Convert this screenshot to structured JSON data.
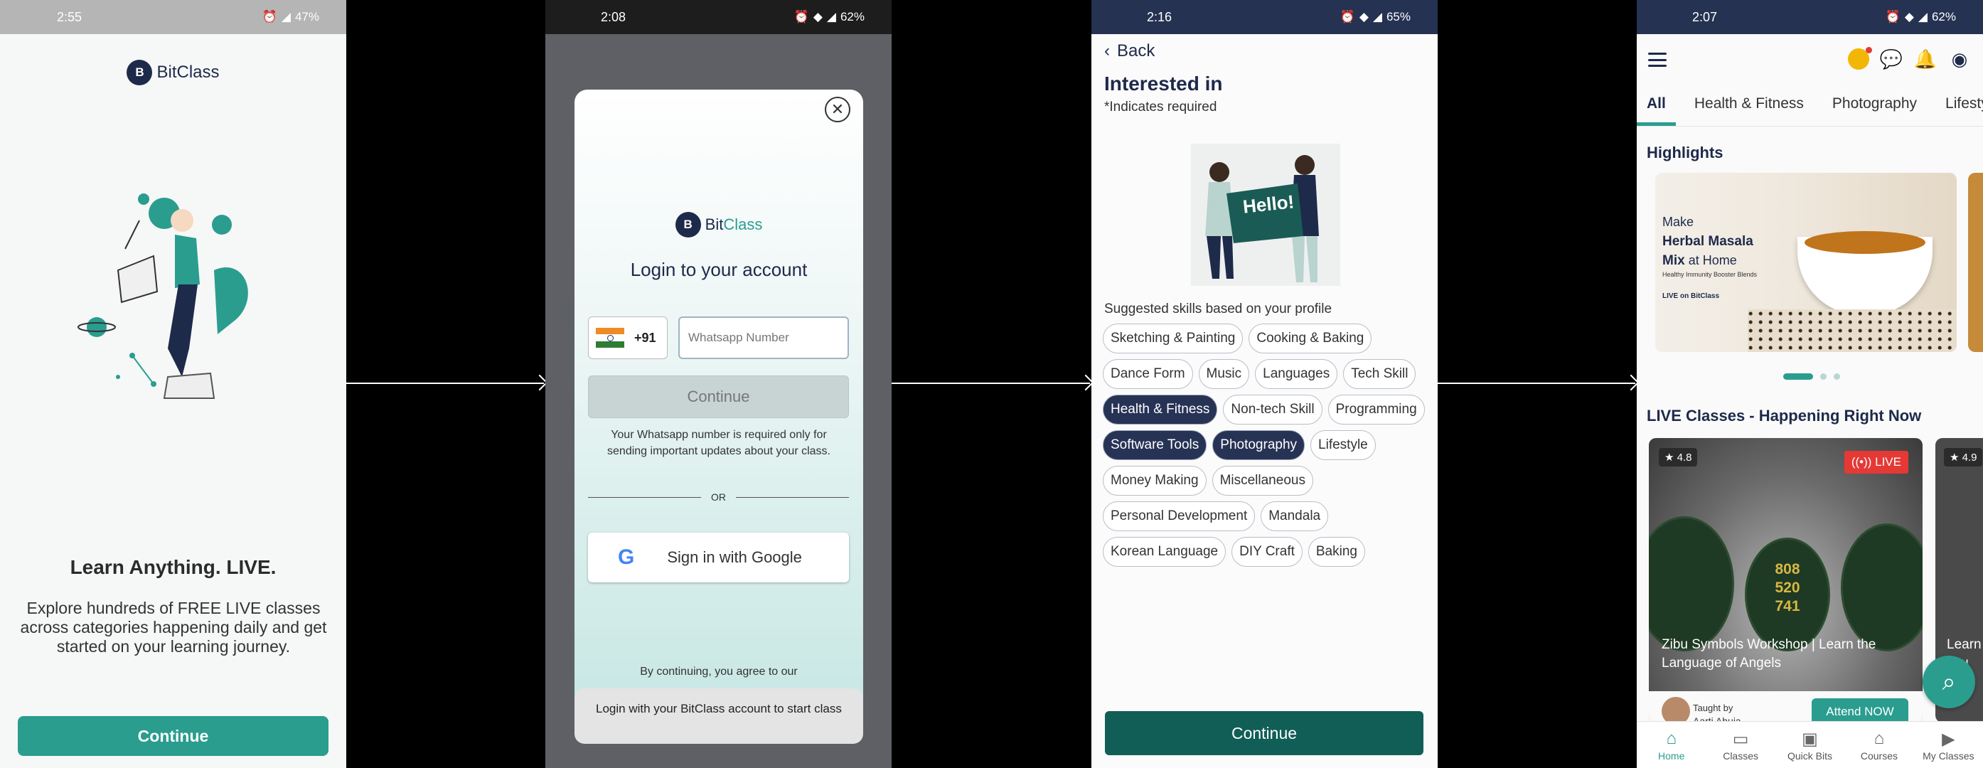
{
  "screen1": {
    "time": "2:55",
    "battery": "47%",
    "brand": {
      "bit": "Bit",
      "class": "Class",
      "logo_letter": "B"
    },
    "heading": "Learn Anything. LIVE.",
    "text": "Explore hundreds of FREE LIVE classes across categories happening daily and get started on your learning journey.",
    "continue_label": "Continue"
  },
  "screen2": {
    "time": "2:08",
    "battery": "62%",
    "close_glyph": "✕",
    "brand": {
      "bit": "Bit",
      "class": "Class",
      "logo_letter": "B"
    },
    "title": "Login to your account",
    "country_code": "+91",
    "phone_placeholder": "Whatsapp Number",
    "continue_label": "Continue",
    "note": "Your Whatsapp number is required only for sending important updates about your class.",
    "or_label": "OR",
    "google_glyph": "G",
    "google_label": "Sign in with Google",
    "agree_text": "By continuing, you agree to our",
    "toast": "Login with your BitClass account to start class"
  },
  "screen3": {
    "time": "2:16",
    "battery": "65%",
    "back_label": "Back",
    "title": "Interested in",
    "subtitle": "*Indicates required",
    "hello_text": "Hello!",
    "suggest_label": "Suggested skills based on your profile",
    "chips": [
      {
        "label": "Sketching & Painting",
        "selected": false
      },
      {
        "label": "Cooking & Baking",
        "selected": false
      },
      {
        "label": "Dance Form",
        "selected": false
      },
      {
        "label": "Music",
        "selected": false
      },
      {
        "label": "Languages",
        "selected": false
      },
      {
        "label": "Tech Skill",
        "selected": false
      },
      {
        "label": "Health & Fitness",
        "selected": true
      },
      {
        "label": "Non-tech Skill",
        "selected": false
      },
      {
        "label": "Programming",
        "selected": false
      },
      {
        "label": "Software Tools",
        "selected": true
      },
      {
        "label": "Photography",
        "selected": true
      },
      {
        "label": "Lifestyle",
        "selected": false
      },
      {
        "label": "Money Making",
        "selected": false
      },
      {
        "label": "Miscellaneous",
        "selected": false
      },
      {
        "label": "Personal Development",
        "selected": false
      },
      {
        "label": "Mandala",
        "selected": false
      },
      {
        "label": "Korean Language",
        "selected": false
      },
      {
        "label": "DIY Craft",
        "selected": false
      },
      {
        "label": "Baking",
        "selected": false
      }
    ],
    "continue_label": "Continue"
  },
  "screen4": {
    "time": "2:07",
    "battery": "62%",
    "tabs": [
      "All",
      "Health & Fitness",
      "Photography",
      "Lifestyle"
    ],
    "highlights_title": "Highlights",
    "highlight": {
      "line1": "Make",
      "line2": "Herbal Masala",
      "line3": "Mix",
      "line3b": " at Home",
      "small": "Healthy Immunity Booster Blends",
      "live_on": "LIVE on BitClass"
    },
    "live_title": "LIVE Classes - Happening Right Now",
    "live_card": {
      "rating": "★ 4.8",
      "live_badge": "((•)) LIVE",
      "stone_numbers": "808\n520\n741",
      "title": "Zibu Symbols Workshop | Learn the Language of Angels",
      "taught_by": "Taught by",
      "teacher": "Aarti Ahuja",
      "attend_label": "Attend NOW"
    },
    "live_card2": {
      "rating": "★ 4.9",
      "title": "Learn\nyou"
    },
    "nav": [
      {
        "label": "Home",
        "icon": "⌂"
      },
      {
        "label": "Classes",
        "icon": "▭"
      },
      {
        "label": "Quick Bits",
        "icon": "▣"
      },
      {
        "label": "Courses",
        "icon": "⌂"
      },
      {
        "label": "My Classes",
        "icon": "▶"
      }
    ],
    "colors": {
      "accent": "#2a9d8f",
      "navy": "#1e2a4a",
      "live": "#e53935"
    }
  }
}
